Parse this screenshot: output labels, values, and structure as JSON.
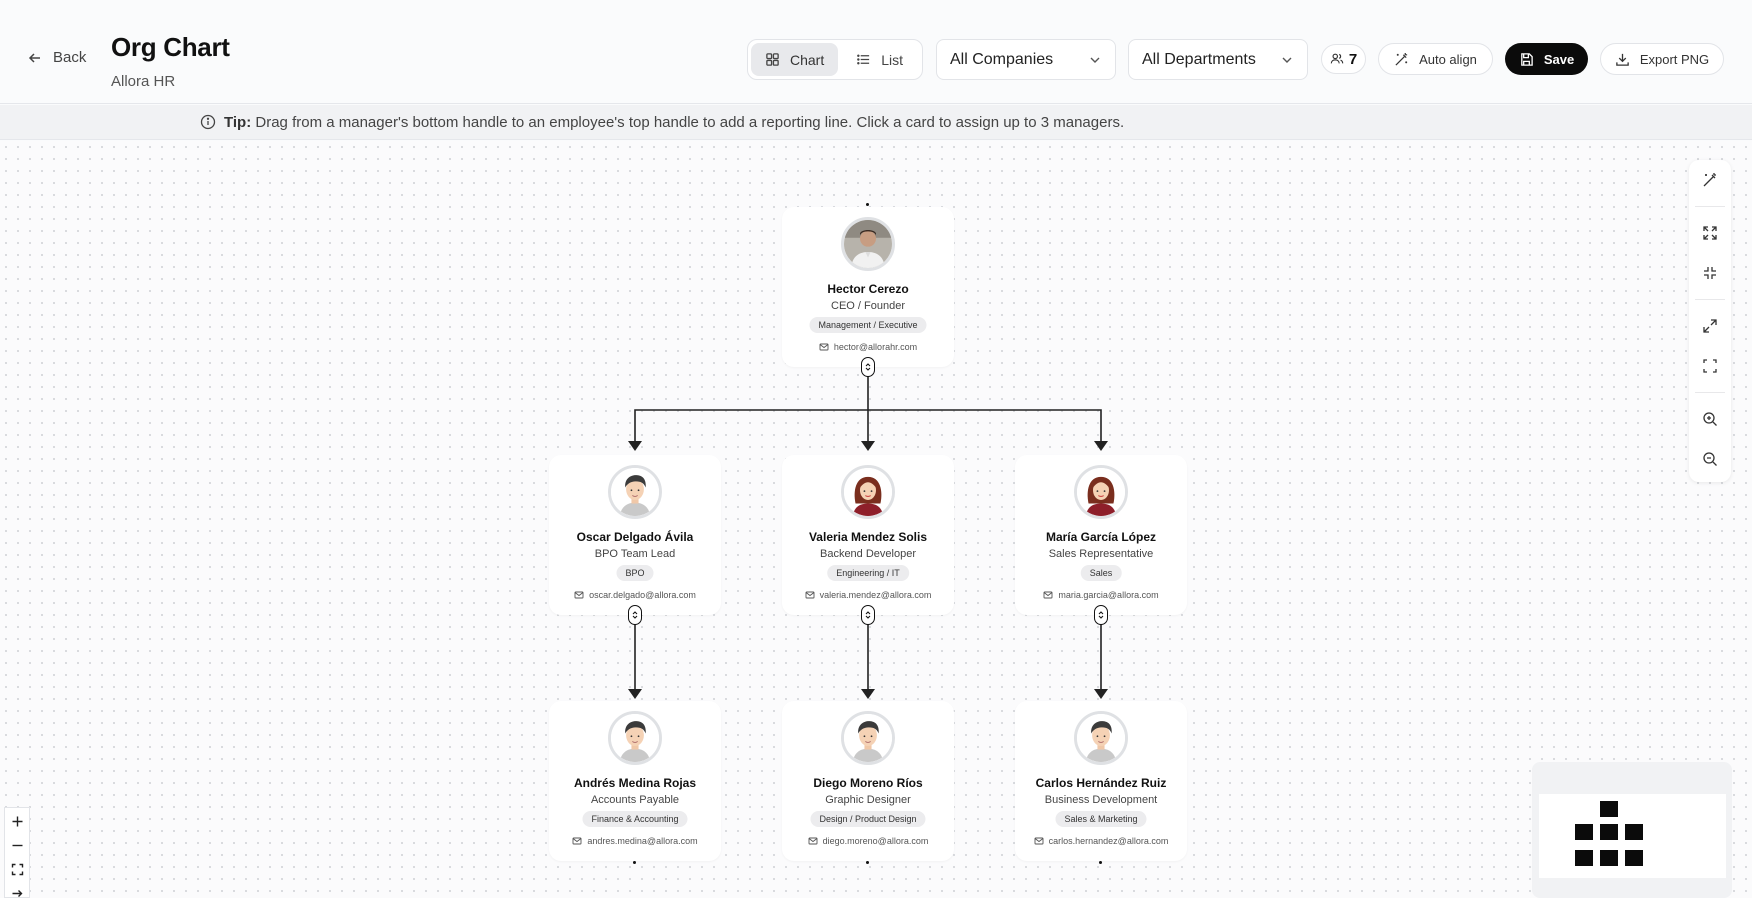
{
  "header": {
    "back_label": "Back",
    "title": "Org Chart",
    "subtitle": "Allora HR",
    "view_tabs": [
      {
        "label": "Chart",
        "icon": "grid-icon",
        "active": true
      },
      {
        "label": "List",
        "icon": "list-icon",
        "active": false
      }
    ],
    "company_filter": "All Companies",
    "department_filter": "All Departments",
    "people_count": "7",
    "auto_align_label": "Auto align",
    "save_label": "Save",
    "export_label": "Export PNG"
  },
  "tip": {
    "prefix": "Tip:",
    "text": "Drag from a manager's bottom handle to an employee's top handle to add a reporting line. Click a card to assign up to 3 managers."
  },
  "nodes": [
    {
      "name": "Hector Cerezo",
      "role": "CEO / Founder",
      "department": "Management / Executive",
      "email": "hector@allorahr.com",
      "avatar": "man-photo"
    },
    {
      "name": "Oscar Delgado Ávila",
      "role": "BPO Team Lead",
      "department": "BPO",
      "email": "oscar.delgado@allora.com",
      "avatar": "man-cartoon"
    },
    {
      "name": "Valeria Mendez Solis",
      "role": "Backend Developer",
      "department": "Engineering / IT",
      "email": "valeria.mendez@allora.com",
      "avatar": "woman-cartoon"
    },
    {
      "name": "María García López",
      "role": "Sales Representative",
      "department": "Sales",
      "email": "maria.garcia@allora.com",
      "avatar": "woman-cartoon"
    },
    {
      "name": "Andrés Medina Rojas",
      "role": "Accounts Payable",
      "department": "Finance & Accounting",
      "email": "andres.medina@allora.com",
      "avatar": "man-cartoon"
    },
    {
      "name": "Diego Moreno Ríos",
      "role": "Graphic Designer",
      "department": "Design / Product Design",
      "email": "diego.moreno@allora.com",
      "avatar": "man-cartoon"
    },
    {
      "name": "Carlos Hernández Ruiz",
      "role": "Business Development",
      "department": "Sales & Marketing",
      "email": "carlos.hernandez@allora.com",
      "avatar": "man-cartoon"
    }
  ],
  "reporting_lines": [
    {
      "manager": "Hector Cerezo",
      "employee": "Oscar Delgado Ávila"
    },
    {
      "manager": "Hector Cerezo",
      "employee": "Valeria Mendez Solis"
    },
    {
      "manager": "Hector Cerezo",
      "employee": "María García López"
    },
    {
      "manager": "Oscar Delgado Ávila",
      "employee": "Andrés Medina Rojas"
    },
    {
      "manager": "Valeria Mendez Solis",
      "employee": "Diego Moreno Ríos"
    },
    {
      "manager": "María García López",
      "employee": "Carlos Hernández Ruiz"
    }
  ],
  "right_toolbar": [
    "magic-wand-icon",
    "expand-icon",
    "collapse-icon",
    "maximize-icon",
    "fit-view-icon",
    "zoom-in-icon",
    "zoom-out-icon"
  ],
  "left_controls": [
    "plus-icon",
    "minus-icon",
    "fit-icon",
    "lock-icon"
  ]
}
